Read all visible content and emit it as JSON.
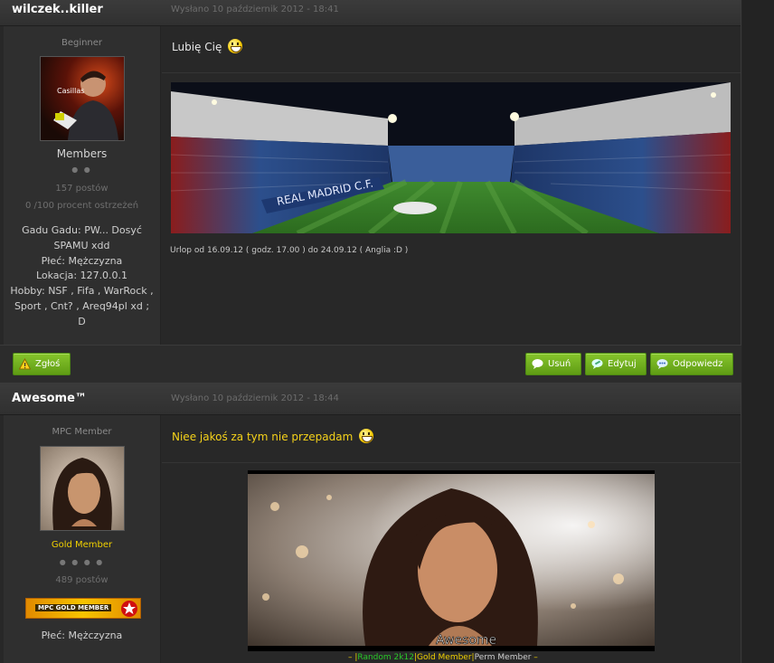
{
  "posts": [
    {
      "author": "wilczek..killer",
      "date": "Wysłano 10 październik 2012 - 18:41",
      "rank_title": "Beginner",
      "group": "Members",
      "rank_pips": "● ●",
      "post_count": "157 postów",
      "warnings": "0 /100 procent ostrzeżeń",
      "fields": [
        "Gadu Gadu: PW... Dosyć SPAMU xdd",
        "Płeć: Mężczyzna",
        "Lokacja: 127.0.0.1",
        "Hobby: NSF , Fifa , WarRock , Sport , Cnt? , Areq94pl xd ; D"
      ],
      "message": "Lubię Cię",
      "signature_text": "Urlop od 16.09.12 ( godz. 17.00 ) do 24.09.12 ( Anglia :D )",
      "avatar_caption": "Casillas",
      "stadium_banner_text": "REAL MADRID C.F."
    },
    {
      "author": "Awesome™",
      "date": "Wysłano 10 październik 2012 - 18:44",
      "rank_title": "MPC Member",
      "group": "Gold Member",
      "rank_pips": "● ● ● ●",
      "post_count": "489 postów",
      "badge": "MPC GOLD MEMBER",
      "fields": [
        "Płeć: Mężczyzna"
      ],
      "message": "Niee jakoś za tym nie przepadam",
      "banner_text": "Awesome",
      "footer_links": [
        "Random 2k12",
        "Gold Member",
        "Perm Member"
      ]
    }
  ],
  "actions": {
    "report": "Zgłoś",
    "delete": "Usuń",
    "edit": "Edytuj",
    "reply": "Odpowiedz"
  },
  "colors": {
    "accent_green": "#6aab1c",
    "gold": "#f0d000",
    "message_yellow": "#f5d21a"
  }
}
